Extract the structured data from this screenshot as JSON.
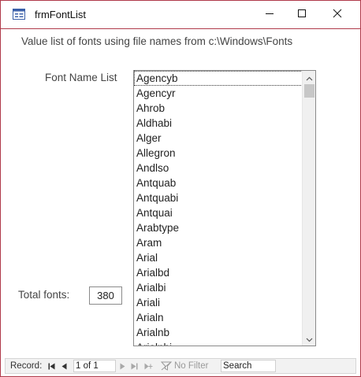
{
  "window": {
    "title": "frmFontList",
    "icons": {
      "app": "form-icon",
      "minimize": "minimize-icon",
      "maximize": "maximize-icon",
      "close": "close-icon"
    }
  },
  "form": {
    "heading": "Value list of fonts using file names from c:\\Windows\\Fonts",
    "font_list_label": "Font Name List",
    "font_list": {
      "selected": "Agencyb",
      "items": [
        "Agencyb",
        "Agencyr",
        "Ahrob",
        "Aldhabi",
        "Alger",
        "Allegron",
        "Andlso",
        "Antquab",
        "Antquabi",
        "Antquai",
        "Arabtype",
        "Aram",
        "Arial",
        "Arialbd",
        "Arialbi",
        "Ariali",
        "Arialn",
        "Arialnb",
        "Arialnbi"
      ]
    },
    "total_label": "Total fonts:",
    "total_value": "380"
  },
  "navigation": {
    "record_label": "Record:",
    "position": "1 of 1",
    "filter_label": "No Filter",
    "search_value": "Search",
    "icons": {
      "first": "first-record-icon",
      "previous": "previous-record-icon",
      "next": "next-record-icon",
      "last": "last-record-icon",
      "new": "new-record-icon",
      "filter": "filter-icon"
    }
  },
  "colors": {
    "window_border": "#b03a4a",
    "scroll_track": "#f0f0f0",
    "scroll_thumb": "#c7c7c7"
  }
}
